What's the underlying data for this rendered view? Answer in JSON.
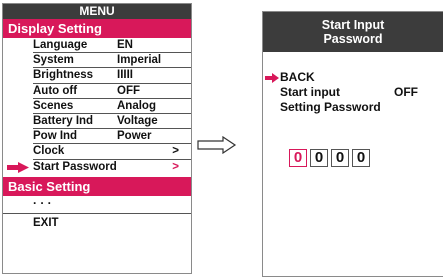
{
  "menu": {
    "title": "MENU",
    "section_display": "Display Setting",
    "items": [
      {
        "label": "Language",
        "value": "EN"
      },
      {
        "label": "System",
        "value": "Imperial"
      },
      {
        "label": "Brightness",
        "value": "IIIII"
      },
      {
        "label": "Auto off",
        "value": "OFF"
      },
      {
        "label": "Scenes",
        "value": "Analog"
      },
      {
        "label": "Battery Ind",
        "value": "Voltage"
      },
      {
        "label": "Pow Ind",
        "value": "Power"
      },
      {
        "label": "Clock",
        "value": ">"
      },
      {
        "label": "Start Password",
        "value": ">"
      }
    ],
    "section_basic": "Basic Setting",
    "dots": "· · ·",
    "exit": "EXIT"
  },
  "password_screen": {
    "title_line1": "Start Input",
    "title_line2": "Password",
    "back": "BACK",
    "start_input_label": "Start input",
    "start_input_value": "OFF",
    "setting_password": "Setting Password",
    "digits": [
      "0",
      "0",
      "0",
      "0"
    ]
  },
  "colors": {
    "accent": "#d8185a",
    "header_bg": "#3c3c3c"
  },
  "icons": {
    "selection": "arrow-right-icon",
    "transition": "hollow-arrow-right-icon"
  }
}
